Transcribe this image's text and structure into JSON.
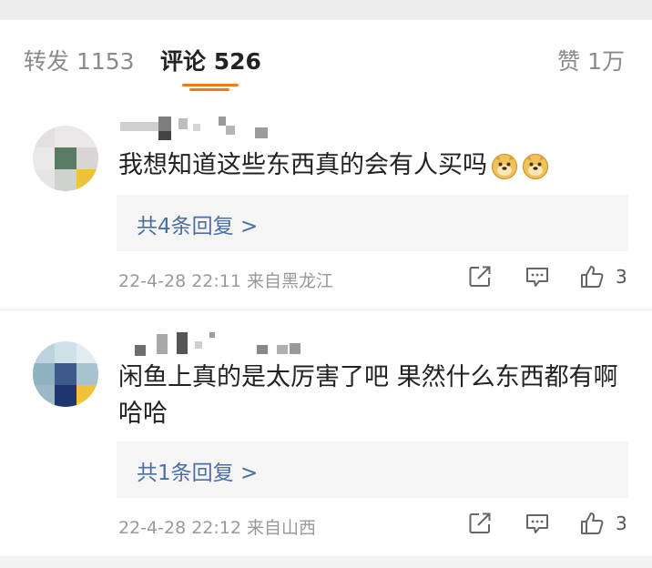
{
  "tabs": {
    "repost": "转发 1153",
    "comments": "评论 526",
    "likes": "赞 1万"
  },
  "comments": [
    {
      "text": "我想知道这些东西真的会有人买吗",
      "emoji": [
        "doge-icon",
        "doge-icon"
      ],
      "reply_link": "共4条回复 >",
      "meta": "22-4-28 22:11  来自黑龙江",
      "likes": "3"
    },
    {
      "text": "闲鱼上真的是太厉害了吧   果然什么东西都有啊哈哈",
      "emoji": [],
      "reply_link": "共1条回复 >",
      "meta": "22-4-28 22:12  来自山西",
      "likes": "3"
    }
  ],
  "colors": {
    "accent": "#f07a1e",
    "link": "#4a6fa5",
    "text": "#222222",
    "muted": "#999999"
  }
}
